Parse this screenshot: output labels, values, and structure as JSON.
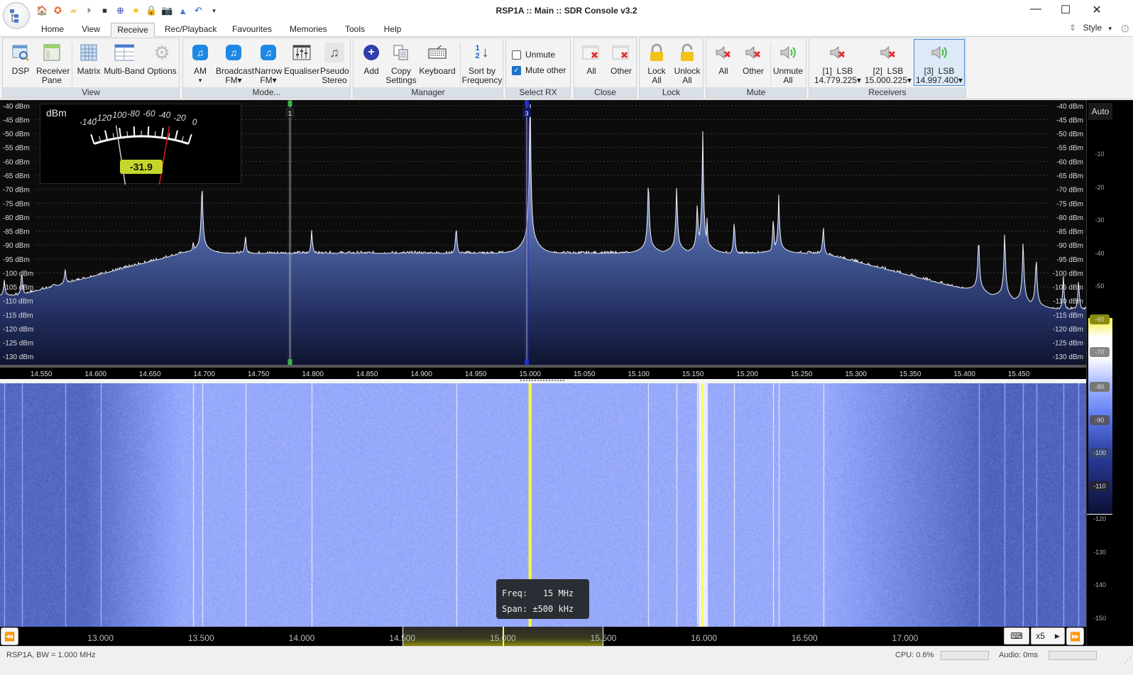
{
  "window": {
    "title": "RSP1A :: Main :: SDR Console v3.2",
    "controls": [
      "minimize",
      "maximize",
      "close"
    ]
  },
  "quick_access": [
    "home-icon",
    "help-lifebuoy-icon",
    "folder-icon",
    "play-icon",
    "stop-icon",
    "add-icon",
    "favourite-star-icon",
    "lock-icon",
    "camera-icon",
    "antenna-icon",
    "undo-icon",
    "dropdown-icon"
  ],
  "tabs": [
    {
      "label": "Home",
      "active": false
    },
    {
      "label": "View",
      "active": false
    },
    {
      "label": "Receive",
      "active": true
    },
    {
      "label": "Rec/Playback",
      "active": false
    },
    {
      "label": "Favourites",
      "active": false
    },
    {
      "label": "Memories",
      "active": false
    },
    {
      "label": "Tools",
      "active": false
    },
    {
      "label": "Help",
      "active": false
    }
  ],
  "style_menu": {
    "label": "Style"
  },
  "ribbon": {
    "view": {
      "label": "View",
      "buttons": [
        {
          "label1": "DSP",
          "label2": ""
        },
        {
          "label1": "Receiver",
          "label2": "Pane"
        },
        {
          "label1": "Matrix",
          "label2": ""
        },
        {
          "label1": "Multi-Band",
          "label2": ""
        },
        {
          "label1": "Options",
          "label2": ""
        }
      ]
    },
    "mode": {
      "label": "Mode...",
      "buttons": [
        {
          "label1": "AM",
          "label2": "▾"
        },
        {
          "label1": "Broadcast",
          "label2": "FM▾"
        },
        {
          "label1": "Narrow",
          "label2": "FM▾"
        },
        {
          "label1": "Equaliser",
          "label2": ""
        },
        {
          "label1": "Pseudo",
          "label2": "Stereo"
        }
      ]
    },
    "manager": {
      "label": "Manager",
      "buttons": [
        {
          "label1": "Add",
          "label2": ""
        },
        {
          "label1": "Copy",
          "label2": "Settings"
        },
        {
          "label1": "Keyboard",
          "label2": ""
        },
        {
          "label1": "Sort by",
          "label2": "Frequency"
        }
      ]
    },
    "select_rx": {
      "label": "Select RX",
      "checkboxes": [
        {
          "label": "Unmute",
          "checked": false
        },
        {
          "label": "Mute other",
          "checked": true
        }
      ]
    },
    "close": {
      "label": "Close",
      "buttons": [
        {
          "label1": "All",
          "label2": ""
        },
        {
          "label1": "Other",
          "label2": ""
        }
      ]
    },
    "lock": {
      "label": "Lock",
      "buttons": [
        {
          "label1": "Lock",
          "label2": "All"
        },
        {
          "label1": "Unlock",
          "label2": "All"
        }
      ]
    },
    "mute": {
      "label": "Mute",
      "buttons": [
        {
          "label1": "All",
          "label2": ""
        },
        {
          "label1": "Other",
          "label2": ""
        },
        {
          "label1": "Unmute",
          "label2": "All"
        }
      ]
    },
    "receivers": {
      "label": "Receivers",
      "items": [
        {
          "label1": "[1]  LSB",
          "label2": "14.779.225▾",
          "muted": true,
          "selected": false
        },
        {
          "label1": "[2]  LSB",
          "label2": "15.000.225▾",
          "muted": true,
          "selected": false
        },
        {
          "label1": "[3]  LSB",
          "label2": "14.997.400▾",
          "muted": false,
          "selected": true
        }
      ]
    }
  },
  "spectrum": {
    "db_labels": [
      "-40 dBm",
      "-45 dBm",
      "-50 dBm",
      "-55 dBm",
      "-60 dBm",
      "-65 dBm",
      "-70 dBm",
      "-75 dBm",
      "-80 dBm",
      "-85 dBm",
      "-90 dBm",
      "-95 dBm",
      "-100 dBm",
      "-105 dBm",
      "-110 dBm",
      "-115 dBm",
      "-120 dBm",
      "-125 dBm",
      "-130 dBm"
    ],
    "freq_labels": [
      "14.550",
      "14.600",
      "14.650",
      "14.700",
      "14.750",
      "14.800",
      "14.850",
      "14.900",
      "14.950",
      "15.000",
      "15.050",
      "15.100",
      "15.150",
      "15.200",
      "15.250",
      "15.300",
      "15.350",
      "15.400",
      "15.450"
    ],
    "freq_range_mhz": [
      14.512,
      15.512
    ],
    "db_range": [
      -133,
      -38
    ],
    "noise_floor_dbm": -93,
    "peaks": [
      {
        "f": 14.516,
        "db": -102
      },
      {
        "f": 14.532,
        "db": -98
      },
      {
        "f": 14.572,
        "db": -98
      },
      {
        "f": 14.605,
        "db": -101
      },
      {
        "f": 14.69,
        "db": -88
      },
      {
        "f": 14.698,
        "db": -70
      },
      {
        "f": 14.738,
        "db": -86
      },
      {
        "f": 14.799,
        "db": -84
      },
      {
        "f": 14.932,
        "db": -82
      },
      {
        "f": 15.0,
        "db": -40
      },
      {
        "f": 15.109,
        "db": -69
      },
      {
        "f": 15.135,
        "db": -72
      },
      {
        "f": 15.154,
        "db": -77
      },
      {
        "f": 15.159,
        "db": -56
      },
      {
        "f": 15.163,
        "db": -80
      },
      {
        "f": 15.188,
        "db": -80
      },
      {
        "f": 15.224,
        "db": -78
      },
      {
        "f": 15.229,
        "db": -76
      },
      {
        "f": 15.27,
        "db": -82
      },
      {
        "f": 15.413,
        "db": -89
      },
      {
        "f": 15.437,
        "db": -88
      },
      {
        "f": 15.454,
        "db": -91
      },
      {
        "f": 15.466,
        "db": -96
      },
      {
        "f": 15.491,
        "db": -100
      },
      {
        "f": 15.505,
        "db": -101
      }
    ],
    "receiver_markers": [
      {
        "id": "1",
        "freq_mhz": 14.779,
        "color": "#3cb44b"
      },
      {
        "id": "3",
        "freq_mhz": 14.997,
        "color": "#1f2fd0"
      }
    ]
  },
  "s_meter": {
    "unit": "dBm",
    "scale": [
      "-140",
      "-120",
      "-100",
      "-80",
      "-60",
      "-40",
      "-20",
      "0"
    ],
    "value": "-31.9",
    "peak_dbm": -31.9,
    "average_dbm": -104
  },
  "sidebar": {
    "auto_label": "Auto",
    "spectrum_scale": [
      "-10",
      "-20",
      "-30",
      "-40",
      "-50",
      "-60",
      "-70"
    ],
    "waterfall_scale": [
      "-80",
      "-90",
      "-100",
      "-110",
      "-120",
      "-130",
      "-140",
      "-150"
    ]
  },
  "waterfall": {
    "freq_labels": [
      "13.000",
      "13.500",
      "14.000",
      "14.500",
      "15.000",
      "15.500",
      "16.000",
      "16.500",
      "17.000"
    ],
    "overview_range_mhz": [
      12.5,
      17.9
    ],
    "zoom_label": "x5",
    "tooltip": {
      "freq_label": "Freq:",
      "freq_value": "15 MHz",
      "span_label": "Span:",
      "span_value": "±500 kHz"
    }
  },
  "status": {
    "device": "RSP1A, BW = 1.000 MHz",
    "cpu": "CPU: 0.6%",
    "audio": "Audio: 0ms"
  }
}
